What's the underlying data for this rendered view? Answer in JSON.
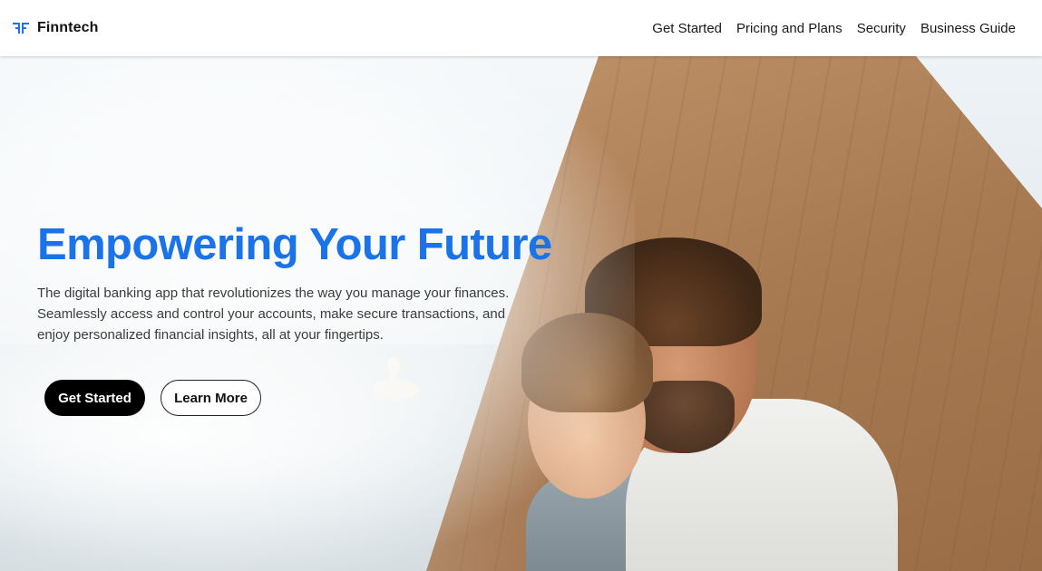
{
  "navbar": {
    "brand_name": "Finntech",
    "brand_icon": "ff-logo-icon",
    "links": [
      {
        "label": "Get Started"
      },
      {
        "label": "Pricing and Plans"
      },
      {
        "label": "Security"
      },
      {
        "label": "Business Guide"
      }
    ]
  },
  "hero": {
    "title": "Empowering Your Future",
    "description": "The digital banking app that revolutionizes the way you manage your finances. Seamlessly access and control your accounts, make secure transactions, and enjoy personalized financial insights, all at your fingertips.",
    "primary_button": "Get Started",
    "secondary_button": "Learn More",
    "background_image": "father-and-daughter-on-wooden-dock-by-lake"
  },
  "colors": {
    "accent": "#1a73e8",
    "primary_button_bg": "#000000",
    "text": "#3c3c3c"
  }
}
